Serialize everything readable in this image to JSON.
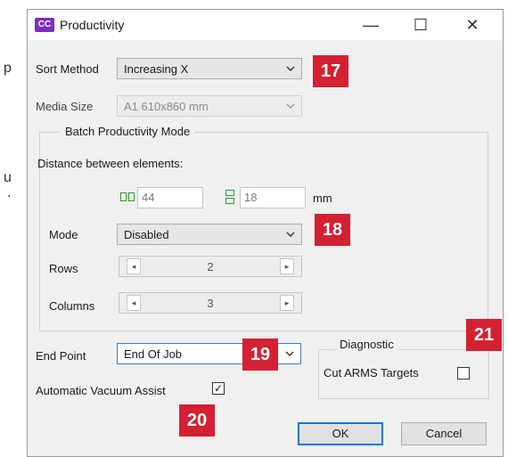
{
  "background_fragments": [
    "p",
    "u",
    "."
  ],
  "window": {
    "app_icon_text": "CC",
    "title": "Productivity",
    "minimize_glyph": "—",
    "maximize_glyph": "☐",
    "close_glyph": "✕"
  },
  "sort_method": {
    "label": "Sort Method",
    "value": "Increasing X",
    "badge": "17"
  },
  "media_size": {
    "label": "Media Size",
    "value": "A1 610x860 mm"
  },
  "batch": {
    "group_title": "Batch Productivity Mode",
    "distance_label": "Distance between elements:",
    "horizontal_value": "44",
    "vertical_value": "18",
    "unit": "mm",
    "mode_label": "Mode",
    "mode_value": "Disabled",
    "mode_badge": "18",
    "rows_label": "Rows",
    "rows_value": "2",
    "columns_label": "Columns",
    "columns_value": "3",
    "spin_left_glyph": "◂",
    "spin_right_glyph": "▸"
  },
  "end_point": {
    "label": "End Point",
    "value": "End Of Job",
    "badge": "19"
  },
  "vacuum": {
    "label": "Automatic Vacuum Assist",
    "checked": true,
    "badge": "20",
    "check_glyph": "✓"
  },
  "diagnostic": {
    "group_title": "Diagnostic",
    "cut_arms_label": "Cut ARMS Targets",
    "checked": false,
    "badge": "21"
  },
  "buttons": {
    "ok": "OK",
    "cancel": "Cancel"
  },
  "colors": {
    "badge": "#d32131",
    "accent": "#0078d7",
    "app_icon": "#7b2fbe"
  },
  "icons": {
    "horizontal_spacing": "horizontal-spacing-icon",
    "vertical_spacing": "vertical-spacing-icon"
  }
}
